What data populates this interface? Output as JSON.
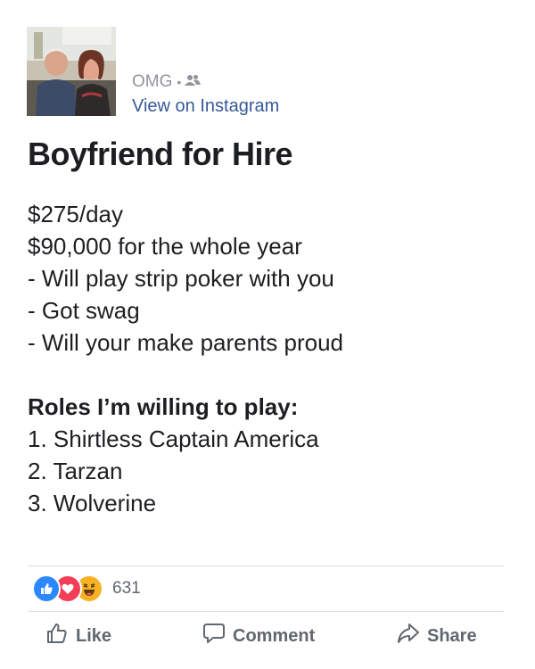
{
  "post": {
    "author_name": "OMG",
    "audience_icon": "friends-icon",
    "view_link": "View on Instagram",
    "title": "Boyfriend for Hire",
    "lines": [
      "$275/day",
      "$90,000 for the whole year",
      "- Will play strip poker with you",
      "- Got swag",
      "- Will your make parents proud"
    ],
    "roles_heading": "Roles I’m willing to play:",
    "roles": [
      "1. Shirtless Captain America",
      "2. Tarzan",
      "3. Wolverine"
    ]
  },
  "reactions": {
    "icons": [
      "like-reaction-icon",
      "love-reaction-icon",
      "haha-reaction-icon"
    ],
    "count": "631"
  },
  "actions": {
    "like": "Like",
    "comment": "Comment",
    "share": "Share"
  },
  "colors": {
    "link": "#365899",
    "muted": "#90949c",
    "like_blue": "#2d88ff",
    "love_red": "#f33e58",
    "haha_yellow": "#f7b125"
  }
}
